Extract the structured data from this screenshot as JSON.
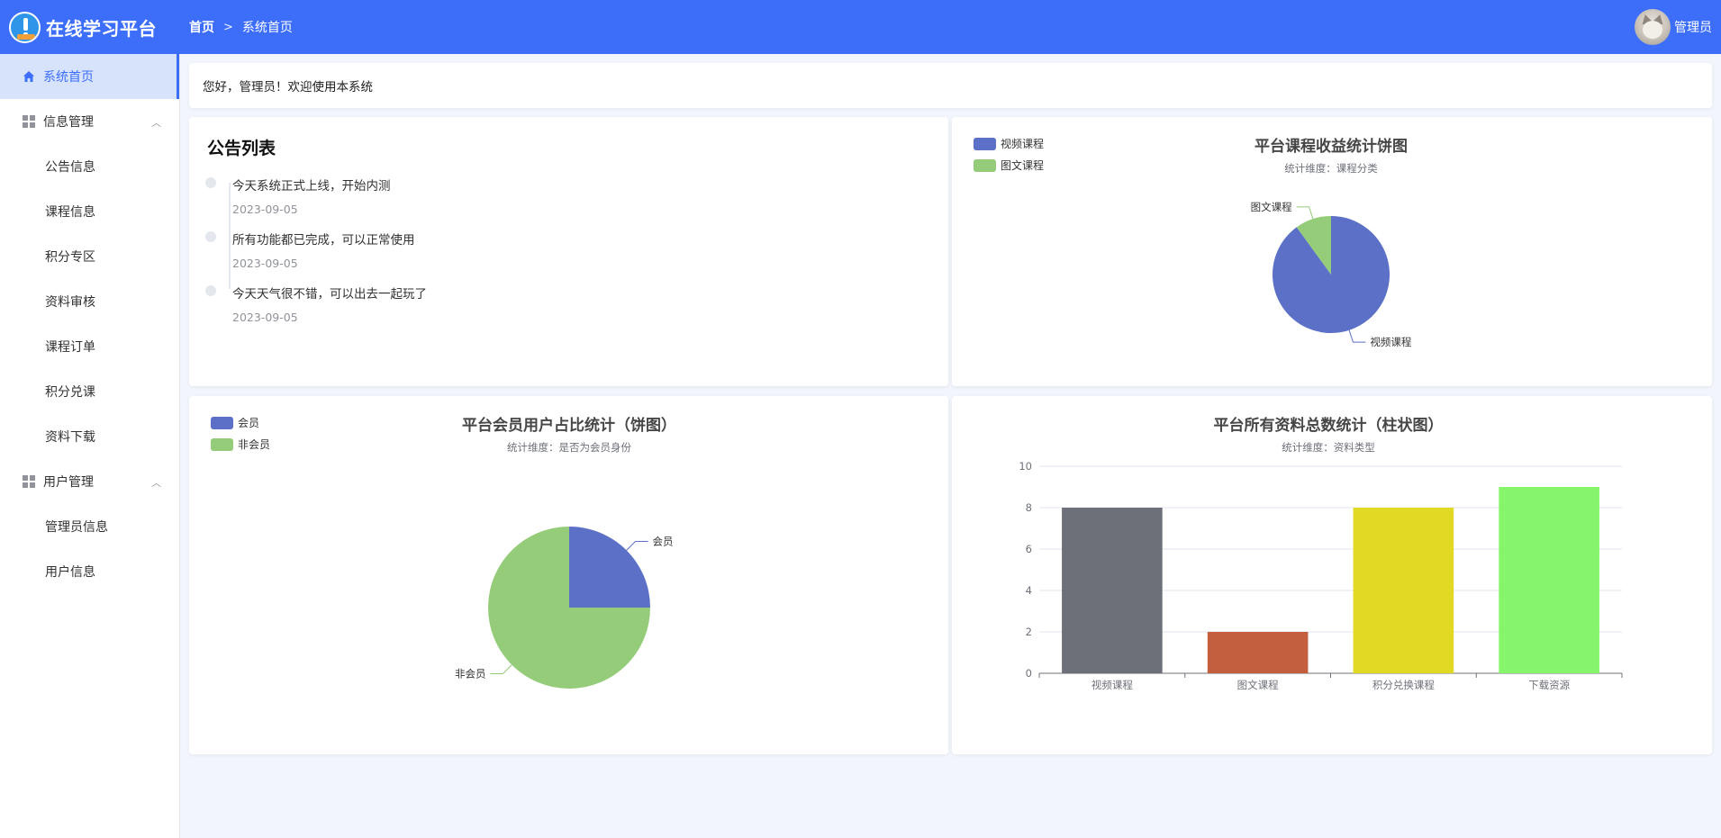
{
  "app": {
    "title": "在线学习平台"
  },
  "breadcrumb": {
    "home": "首页",
    "current": "系统首页"
  },
  "user": {
    "name": "管理员"
  },
  "sidebar": {
    "items": [
      {
        "label": "系统首页",
        "icon": "home-icon"
      },
      {
        "label": "信息管理",
        "icon": "grid-icon"
      },
      {
        "label": "公告信息"
      },
      {
        "label": "课程信息"
      },
      {
        "label": "积分专区"
      },
      {
        "label": "资料审核"
      },
      {
        "label": "课程订单"
      },
      {
        "label": "积分兑课"
      },
      {
        "label": "资料下载"
      },
      {
        "label": "用户管理",
        "icon": "grid-icon"
      },
      {
        "label": "管理员信息"
      },
      {
        "label": "用户信息"
      }
    ]
  },
  "welcome": "您好，管理员！欢迎使用本系统",
  "notices": {
    "title": "公告列表",
    "items": [
      {
        "content": "今天系统正式上线，开始内测",
        "date": "2023-09-05"
      },
      {
        "content": "所有功能都已完成，可以正常使用",
        "date": "2023-09-05"
      },
      {
        "content": "今天天气很不错，可以出去一起玩了",
        "date": "2023-09-05"
      }
    ]
  },
  "colors": {
    "accent": "#3c6efa",
    "pie_blue": "#5b70c6",
    "pie_green": "#95cc79",
    "bar_colors": [
      "#6e7079",
      "#c35f3f",
      "#e2d924",
      "#86f56b"
    ]
  },
  "chart_data": [
    {
      "type": "pie",
      "title": "平台课程收益统计饼图",
      "subtitle": "统计维度：课程分类",
      "legend": [
        "视频课程",
        "图文课程"
      ],
      "legend_position": "top-left",
      "slices": [
        {
          "name": "视频课程",
          "value": 90
        },
        {
          "name": "图文课程",
          "value": 10
        }
      ]
    },
    {
      "type": "pie",
      "title": "平台会员用户占比统计（饼图）",
      "subtitle": "统计维度：是否为会员身份",
      "legend": [
        "会员",
        "非会员"
      ],
      "legend_position": "top-left",
      "slices": [
        {
          "name": "会员",
          "value": 25
        },
        {
          "name": "非会员",
          "value": 75
        }
      ]
    },
    {
      "type": "bar",
      "title": "平台所有资料总数统计（柱状图）",
      "subtitle": "统计维度：资料类型",
      "categories": [
        "视频课程",
        "图文课程",
        "积分兑换课程",
        "下载资源"
      ],
      "values": [
        8,
        2,
        8,
        9
      ],
      "ylim": [
        0,
        10
      ],
      "yticks": [
        0,
        2,
        4,
        6,
        8,
        10
      ],
      "grid": true
    }
  ]
}
